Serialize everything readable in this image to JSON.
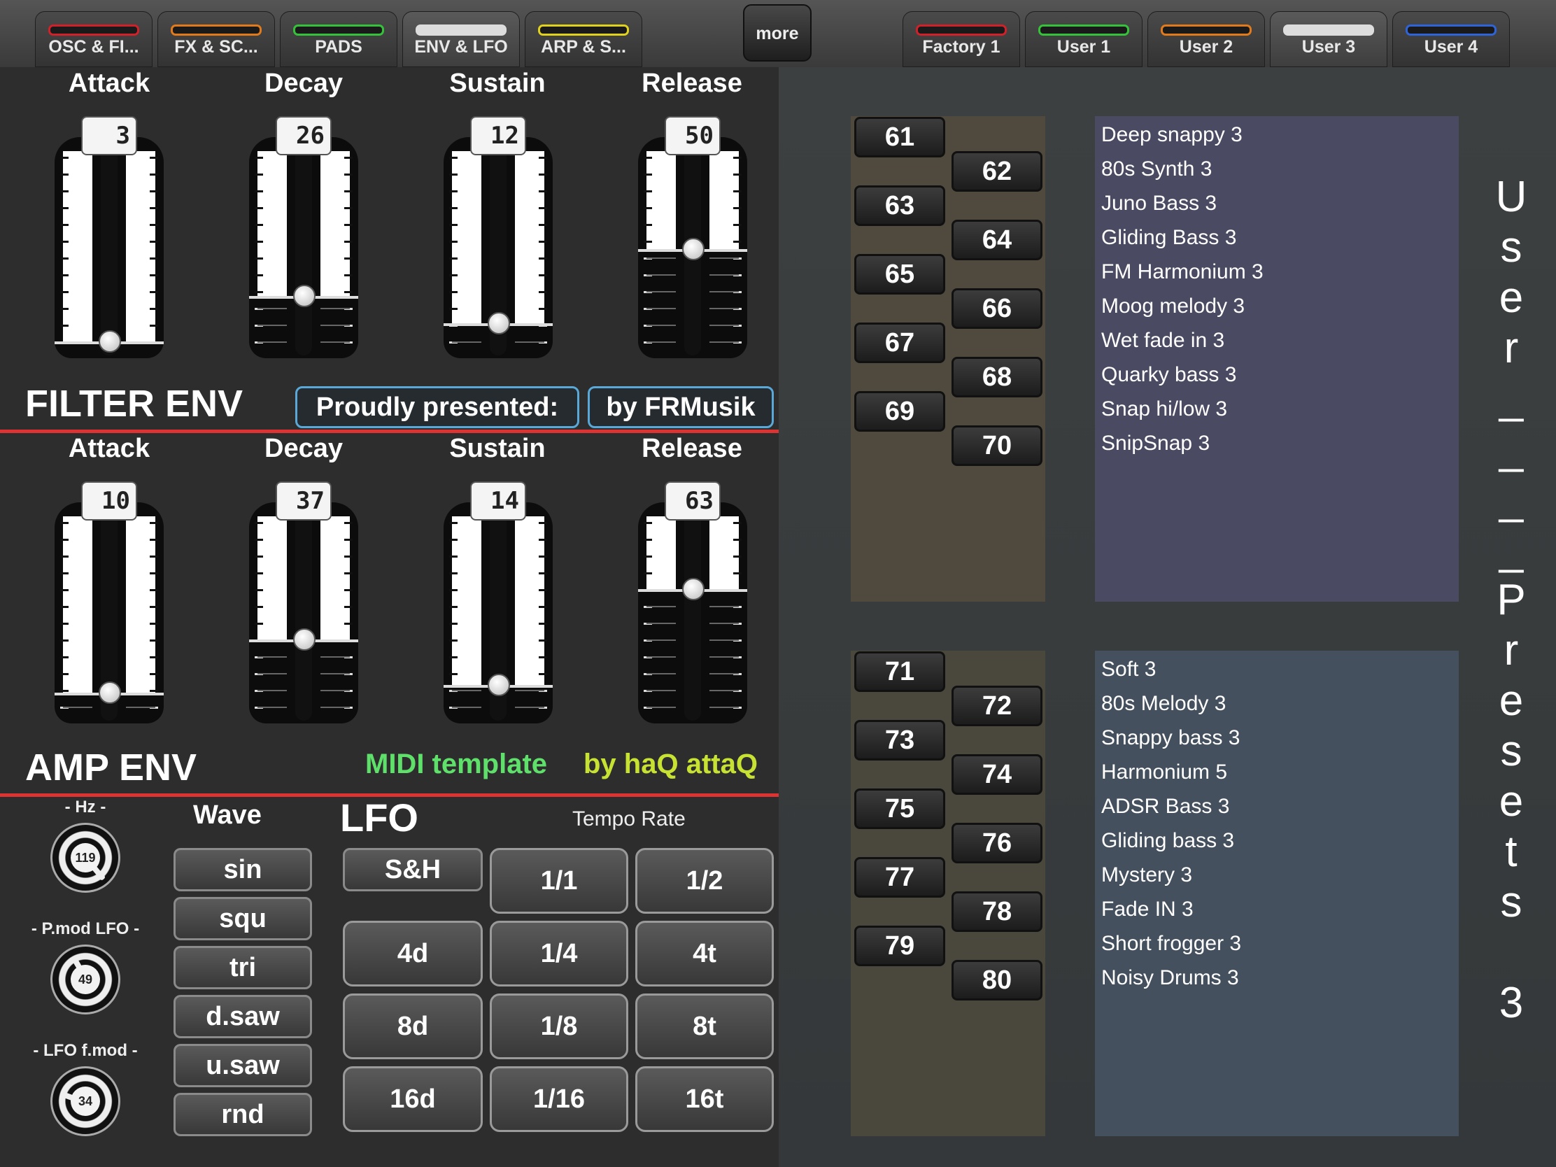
{
  "tabs_left": [
    {
      "label": "OSC & FI...",
      "color": "#d0212a"
    },
    {
      "label": "FX & SC...",
      "color": "#e07a1a"
    },
    {
      "label": "PADS",
      "color": "#35c23a"
    },
    {
      "label": "ENV & LFO",
      "color": "#dddddd"
    },
    {
      "label": "ARP & S...",
      "color": "#e0d21c"
    }
  ],
  "more_label": "more",
  "tabs_right": [
    {
      "label": "Factory 1",
      "color": "#d0212a"
    },
    {
      "label": "User 1",
      "color": "#35c23a"
    },
    {
      "label": "User 2",
      "color": "#e07a1a"
    },
    {
      "label": "User 3",
      "color": "#dddddd"
    },
    {
      "label": "User 4",
      "color": "#2f64d8"
    }
  ],
  "filter_env": {
    "title": "FILTER ENV",
    "headers": [
      "Attack",
      "Decay",
      "Sustain",
      "Release"
    ],
    "values": [
      "3",
      "26",
      "12",
      "50"
    ],
    "levels": [
      0.03,
      0.26,
      0.12,
      0.5
    ]
  },
  "amp_env": {
    "title": "AMP ENV",
    "headers": [
      "Attack",
      "Decay",
      "Sustain",
      "Release"
    ],
    "values": [
      "10",
      "37",
      "14",
      "63"
    ],
    "levels": [
      0.1,
      0.37,
      0.14,
      0.63
    ]
  },
  "credits": {
    "proud": "Proudly presented:",
    "by": "by FRMusik",
    "midi": "MIDI template",
    "haq": "by haQ attaQ"
  },
  "lfo": {
    "title": "LFO",
    "wave_label": "Wave",
    "tempo_label": "Tempo Rate",
    "waves": [
      "sin",
      "squ",
      "tri",
      "d.saw",
      "u.saw",
      "rnd"
    ],
    "sh": "S&H",
    "rates": [
      "1/1",
      "1/2",
      "4d",
      "1/4",
      "4t",
      "8d",
      "1/8",
      "8t",
      "16d",
      "1/16",
      "16t"
    ],
    "knobs": [
      {
        "label": "- Hz -",
        "value": "119"
      },
      {
        "label": "- P.mod LFO -",
        "value": "49"
      },
      {
        "label": "- LFO f.mod -",
        "value": "34"
      }
    ]
  },
  "presets": {
    "numbers_a": [
      "61",
      "62",
      "63",
      "64",
      "65",
      "66",
      "67",
      "68",
      "69",
      "70"
    ],
    "names_a": [
      "Deep snappy 3",
      "80s Synth 3",
      "Juno Bass 3",
      "Gliding Bass 3",
      "FM Harmonium 3",
      "Moog melody 3",
      "Wet fade in 3",
      "Quarky bass 3",
      "Snap hi/low 3",
      "SnipSnap 3"
    ],
    "numbers_b": [
      "71",
      "72",
      "73",
      "74",
      "75",
      "76",
      "77",
      "78",
      "79",
      "80"
    ],
    "names_b": [
      "Soft 3",
      "80s Melody 3",
      "Snappy bass 3",
      "Harmonium 5",
      "ADSR Bass 3",
      "Gliding bass 3",
      "Mystery 3",
      "Fade IN 3",
      "Short frogger 3",
      "Noisy Drums 3"
    ],
    "side_chars": [
      "U",
      "s",
      "e",
      "r",
      "_",
      "_",
      "_",
      "_",
      "P",
      "r",
      "e",
      "s",
      "e",
      "t",
      "s",
      "",
      "3"
    ]
  }
}
